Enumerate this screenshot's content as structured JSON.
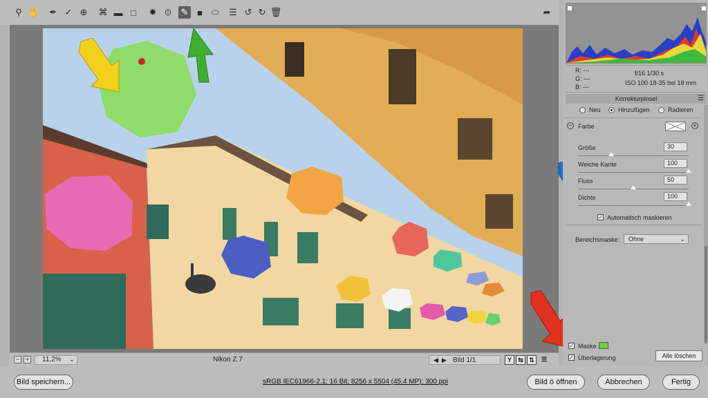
{
  "toolbar": {
    "icons": [
      "zoom-icon",
      "hand-icon",
      "white-balance-icon",
      "color-sampler-icon",
      "target-adjustment-icon",
      "crop-icon",
      "straighten-icon",
      "transform-icon",
      "spot-removal-icon",
      "red-eye-icon",
      "adjustment-brush-icon",
      "graduated-filter-icon",
      "radial-filter-icon",
      "list-icon",
      "rotate-left-icon",
      "rotate-right-icon",
      "trash-icon",
      "export-icon"
    ],
    "active_tool": "adjustment-brush-icon"
  },
  "status": {
    "zoom": "11,2%",
    "camera": "Nikon Z 7",
    "page": "Bild 1/1"
  },
  "info": {
    "r": "R:  ---",
    "g": "G:  ---",
    "b": "B:  ---",
    "exif_line1": "f/16   1/30 s",
    "exif_line2": "ISO 100   18-35 bei 18 mm"
  },
  "panel": {
    "title": "Korrekturpinsel",
    "modes": [
      "Neu",
      "Hinzufügen",
      "Radieren"
    ],
    "selected_mode": "Hinzufügen",
    "color_label": "Farbe",
    "sliders": [
      {
        "label": "Größe",
        "value": "30",
        "fraction": 0.3
      },
      {
        "label": "Weiche Kante",
        "value": "100",
        "fraction": 1.0
      },
      {
        "label": "Fluss",
        "value": "50",
        "fraction": 0.5
      },
      {
        "label": "Dichte",
        "value": "100",
        "fraction": 1.0
      }
    ],
    "auto_mask_label": "Automatisch maskieren",
    "range_mask_label": "Bereichsmaske:",
    "range_mask_value": "Ohne",
    "mask_label": "Maske",
    "overlay_label": "Überlagerung",
    "clear_all_label": "Alle löschen",
    "mask_color": "#6fcf3d"
  },
  "footer": {
    "save_label": "Bild speichern...",
    "file_info": "sRGB IEC61966-2.1; 16 Bit; 8256 x 5504 (45.4 MP); 300 ppi",
    "open_label": "Bild ö öffnen",
    "cancel_label": "Abbrechen",
    "done_label": "Fertig"
  },
  "annotations": {
    "arrow_colors": [
      "#f2d21b",
      "#3fae2e",
      "#1f6fd1",
      "#e0321e"
    ]
  }
}
